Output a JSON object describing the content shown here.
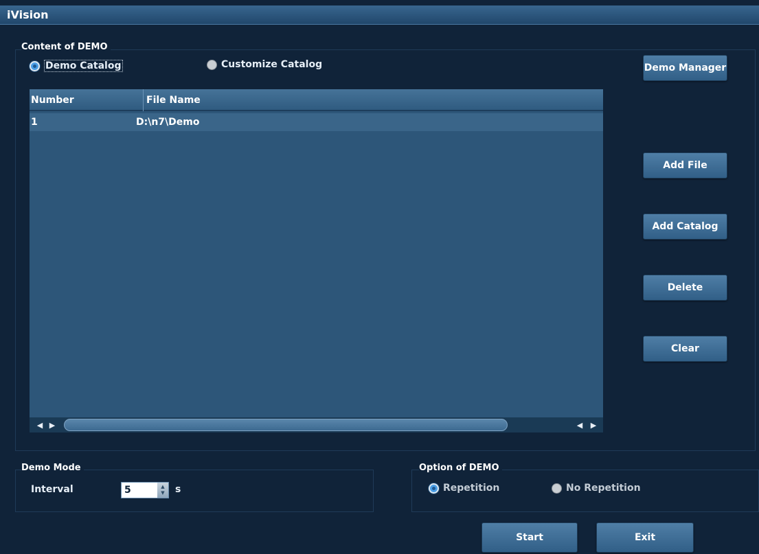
{
  "window": {
    "title": "iVision"
  },
  "content": {
    "group_label": "Content of DEMO",
    "radio_demo_catalog": "Demo Catalog",
    "radio_customize_catalog": "Customize Catalog",
    "selected": "Demo Catalog"
  },
  "table": {
    "columns": [
      "Number",
      "File Name"
    ],
    "rows": [
      {
        "number": "1",
        "file_name": "D:\\n7\\Demo"
      }
    ]
  },
  "buttons": {
    "demo_manager": "Demo Manager",
    "add_file": "Add File",
    "add_catalog": "Add Catalog",
    "delete": "Delete",
    "clear": "Clear",
    "start": "Start",
    "exit": "Exit"
  },
  "demo_mode": {
    "group_label": "Demo Mode",
    "interval_label": "Interval",
    "interval_value": "5",
    "unit": "s"
  },
  "option": {
    "group_label": "Option of DEMO",
    "repetition": "Repetition",
    "no_repetition": "No Repetition",
    "selected": "Repetition"
  },
  "colors": {
    "background": "#102339",
    "title_bar": "#2c5a82",
    "table_body": "#2d5679",
    "button": "#3f6d95",
    "radio_selected": "#4a9ee6"
  },
  "icons": {
    "scroll_left": "◀",
    "scroll_right": "▶",
    "spin_up": "▲",
    "spin_down": "▼"
  }
}
